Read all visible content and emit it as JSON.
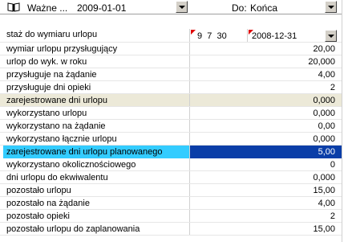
{
  "header": {
    "type_label": "Ważne ...",
    "from_date": "2009-01-01",
    "to_label": "Do:",
    "to_value": "Końca"
  },
  "staz": {
    "label": "staż do wymiaru urlopu",
    "years_months_days": "9  7  30",
    "date": "2008-12-31"
  },
  "rows": [
    {
      "label": "wymiar urlopu przysługujący",
      "value": "20,00"
    },
    {
      "label": "urlop do wyk. w roku",
      "value": "20,000"
    },
    {
      "label": "przysługuje na żądanie",
      "value": "4,00"
    },
    {
      "label": "przysługuje dni opieki",
      "value": "2"
    },
    {
      "label": "zarejestrowane dni urlopu",
      "value": "0,000"
    },
    {
      "label": "wykorzystano urlopu",
      "value": "0,000"
    },
    {
      "label": "wykorzystano na żądanie",
      "value": "0,00"
    },
    {
      "label": "wykorzystano łącznie urlopu",
      "value": "0,000"
    },
    {
      "label": "zarejestrowane dni urlopu planowanego",
      "value": "5,00"
    },
    {
      "label": "wykorzystano okolicznościowego",
      "value": "0"
    },
    {
      "label": "dni urlopu do ekwiwalentu",
      "value": "0,000"
    },
    {
      "label": "pozostało urlopu",
      "value": "15,00"
    },
    {
      "label": "pozostało na żądanie",
      "value": "4,00"
    },
    {
      "label": "pozostało opieki",
      "value": "2"
    },
    {
      "label": "pozostało urlopu do zaplanowania",
      "value": "15,00"
    }
  ],
  "colors": {
    "selected_label_bg": "#33ccff",
    "selected_value_bg": "#0a3ea8",
    "readonly_bg": "#ece9d8"
  }
}
